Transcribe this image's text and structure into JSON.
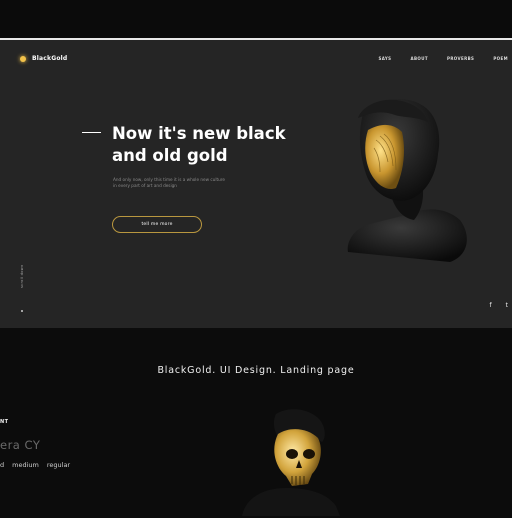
{
  "brand": {
    "logo_text": "BlackGold",
    "accent": "#f2c24a",
    "border_accent": "#b9973f"
  },
  "nav": {
    "items": [
      "SAYS",
      "ABOUT",
      "PROVERBS",
      "POEM"
    ]
  },
  "hero": {
    "headline_line1": "Now it's new black",
    "headline_line2": "and old gold",
    "subtext_line1": "And only now, only this time it is a whole new culture",
    "subtext_line2": "in every part of art and design",
    "cta_label": "tell me more",
    "scroll_label": "scroll down",
    "social": [
      "f",
      "t"
    ]
  },
  "presentation": {
    "title": "BlackGold. UI Design. Landing page",
    "font_label": "NT",
    "font_name": "era CY",
    "weights": [
      "d",
      "medium",
      "regular"
    ]
  }
}
